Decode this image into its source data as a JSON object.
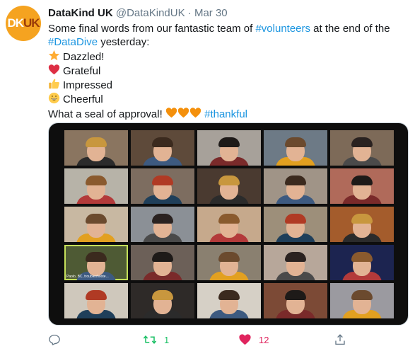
{
  "tweet": {
    "avatar_text_a": "DK",
    "avatar_text_b": "UK",
    "display_name": "DataKind UK",
    "handle": "@DataKindUK",
    "separator": "·",
    "date": "Mar 30",
    "line1_a": "Some final words from our fantastic team of ",
    "line1_link": "#volunteers",
    "line1_b": " at the end of the",
    "line2_link": "#DataDive",
    "line2_b": " yesterday:",
    "feelings": [
      {
        "icon": "star-emoji",
        "label": "Dazzled!"
      },
      {
        "icon": "red-heart-emoji",
        "label": "Grateful"
      },
      {
        "icon": "thumbs-up-emoji",
        "label": "Impressed"
      },
      {
        "icon": "grinning-face-emoji",
        "label": "Cheerful"
      }
    ],
    "closing": "What a seal of approval! ",
    "closing_link": "#thankful"
  },
  "media": {
    "active_tile_label": "Paolo, BC, troubleshoote..."
  },
  "actions": {
    "reply_icon": "reply-icon",
    "retweet_icon": "retweet-icon",
    "retweet_count": "1",
    "like_icon": "heart-icon",
    "like_count": "12",
    "share_icon": "share-icon"
  },
  "colors": {
    "link": "#1b95e0",
    "retweet": "#17bf63",
    "like": "#e0245e",
    "avatar_bg": "#f5a320"
  }
}
